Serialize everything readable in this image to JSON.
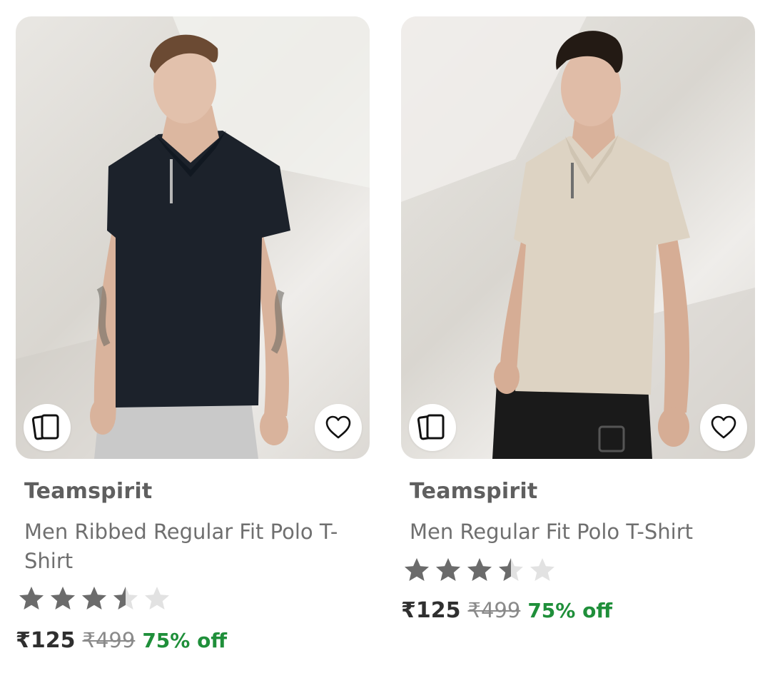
{
  "products": [
    {
      "brand": "Teamspirit",
      "title": "Men Ribbed Regular Fit Polo T-Shirt",
      "rating": 3.5,
      "price": "₹125",
      "mrp": "₹499",
      "discount": "75% off",
      "shirt_color": "#1c222b",
      "pants_color": "#c9c9c9",
      "icons": {
        "similar": "similar-products-icon",
        "wishlist": "heart-icon"
      }
    },
    {
      "brand": "Teamspirit",
      "title": "Men Regular Fit Polo T-Shirt",
      "rating": 3.5,
      "price": "₹125",
      "mrp": "₹499",
      "discount": "75% off",
      "shirt_color": "#ddd3c3",
      "pants_color": "#1a1a1a",
      "icons": {
        "similar": "similar-products-icon",
        "wishlist": "heart-icon"
      }
    }
  ],
  "colors": {
    "star_filled": "#6b6b6b",
    "star_empty": "#e2e2e2",
    "discount": "#1f8f3a"
  }
}
